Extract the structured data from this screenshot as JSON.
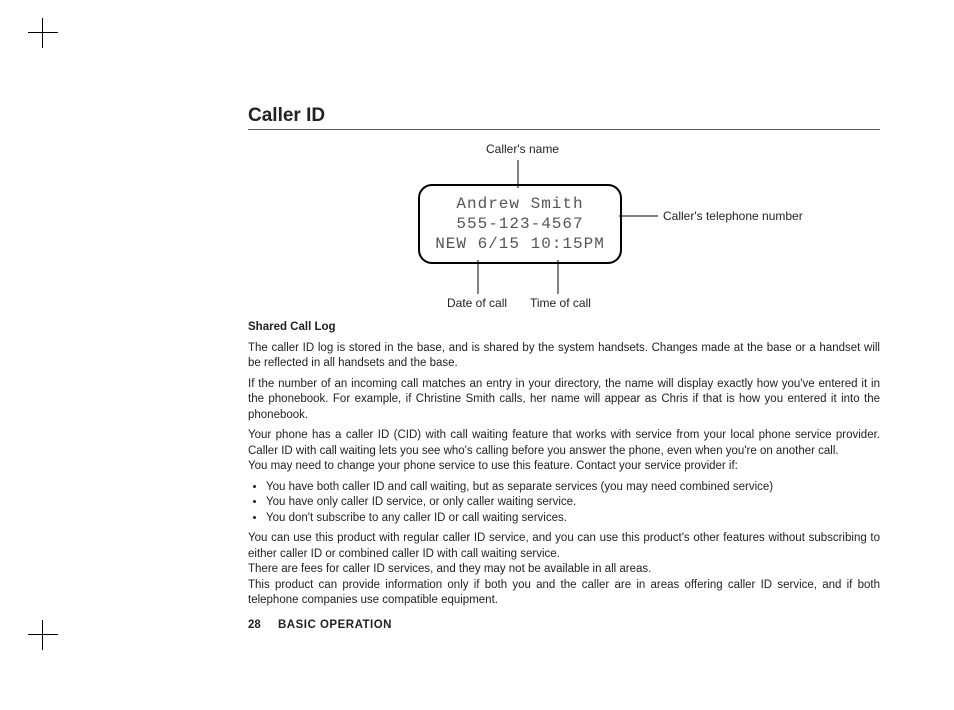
{
  "page": {
    "number": "28",
    "section": "BASIC OPERATION",
    "title": "Caller ID"
  },
  "diagram": {
    "labels": {
      "callerName": "Caller's name",
      "callerNumber": "Caller's telephone number",
      "dateOfCall": "Date of call",
      "timeOfCall": "Time of call"
    },
    "lcd": {
      "line1": "Andrew Smith",
      "line2": "555-123-4567",
      "line3": "NEW 6/15 10:15PM"
    }
  },
  "body": {
    "subhead": "Shared Call Log",
    "p1": "The caller ID log is stored in the base, and is shared by the system handsets. Changes made at the base or a handset will be reflected in all handsets and the base.",
    "p2": "If the number of an incoming call matches an entry in your directory, the name will display exactly how you've entered it in the phonebook. For example, if Christine Smith calls, her name will appear as Chris if that is how you entered it into the phonebook.",
    "p3": "Your phone has a caller ID (CID) with call waiting feature that works with service from your local phone service provider. Caller ID with call waiting lets you see who's calling before you answer the phone, even when you're on another call.",
    "p4": "You may need to change your phone service to use this feature. Contact your service provider if:",
    "bullets": [
      "You have both caller ID and call waiting, but as separate services (you may need combined service)",
      "You have only caller ID service, or only caller waiting service.",
      "You don't subscribe to any caller ID or call waiting services."
    ],
    "p5": "You can use this product with regular caller ID service, and you can use this product's other features without subscribing to either caller ID or combined caller ID with call waiting service.",
    "p6": "There are fees for caller ID services, and they may not be available in all areas.",
    "p7": "This product can provide information only if both you and the caller are in areas offering caller ID service, and if both telephone companies use compatible equipment."
  }
}
